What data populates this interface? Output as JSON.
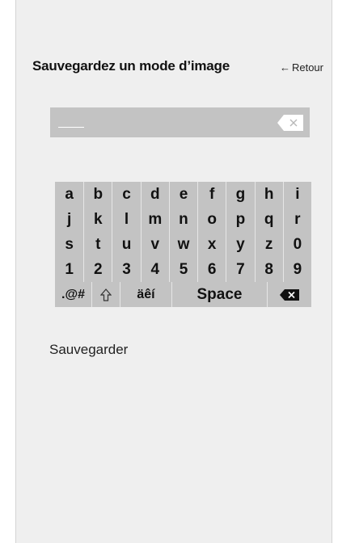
{
  "header": {
    "title": "Sauvegardez un mode d’image",
    "back_label": "Retour",
    "back_icon": "arrow-left-icon"
  },
  "input": {
    "value": "",
    "clear_icon": "clear-x-icon"
  },
  "keyboard": {
    "rows": [
      [
        "a",
        "b",
        "c",
        "d",
        "e",
        "f",
        "g",
        "h",
        "i"
      ],
      [
        "j",
        "k",
        "l",
        "m",
        "n",
        "o",
        "p",
        "q",
        "r"
      ],
      [
        "s",
        "t",
        "u",
        "v",
        "w",
        "x",
        "y",
        "z",
        "0"
      ],
      [
        "1",
        "2",
        "3",
        "4",
        "5",
        "6",
        "7",
        "8",
        "9"
      ]
    ],
    "symbols_label": ".@#",
    "shift_icon": "shift-icon",
    "accents_label": "äêí",
    "space_label": "Space",
    "delete_icon": "backspace-icon"
  },
  "actions": {
    "save_label": "Sauvegarder"
  },
  "colors": {
    "panel": "#efefef",
    "field": "#c3c3c3",
    "keyboard": "#c3c3c3",
    "text": "#111111"
  }
}
